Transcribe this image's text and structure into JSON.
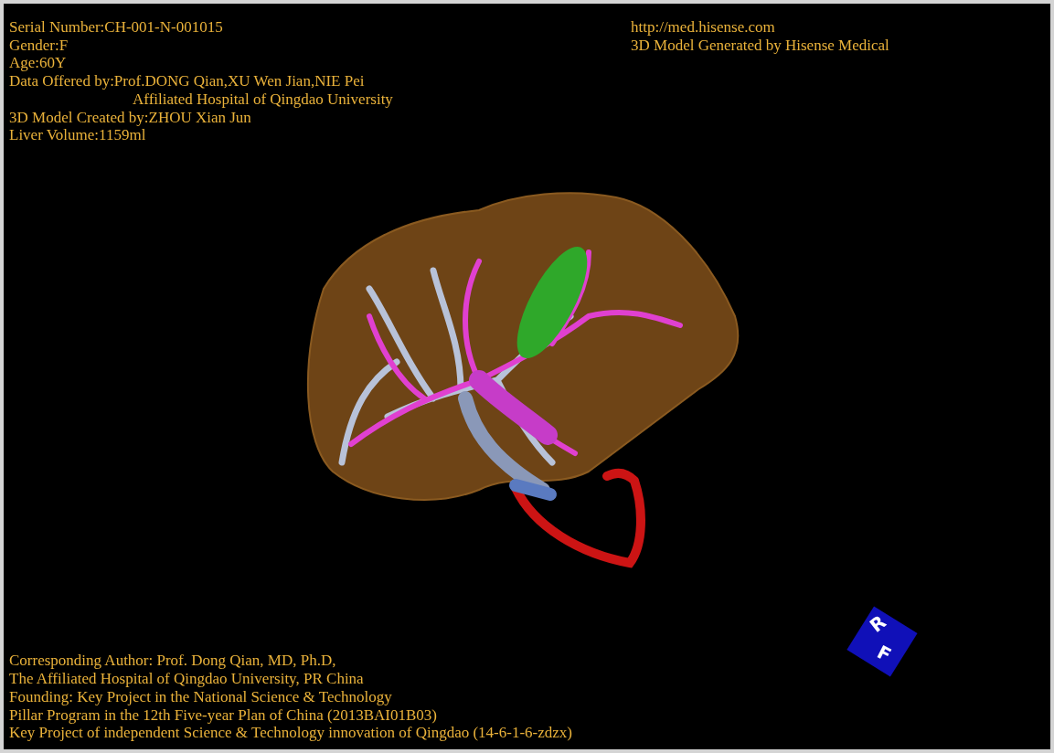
{
  "header_left": [
    {
      "text": "Serial Number:CH-001-N-001015",
      "indented": false
    },
    {
      "text": "Gender:F",
      "indented": false
    },
    {
      "text": "Age:60Y",
      "indented": false
    },
    {
      "text": "Data Offered by:Prof.DONG Qian,XU Wen Jian,NIE Pei",
      "indented": false
    },
    {
      "text": "Affiliated Hospital of Qingdao University",
      "indented": true
    },
    {
      "text": "3D Model Created by:ZHOU Xian Jun",
      "indented": false
    },
    {
      "text": "Liver Volume:1159ml",
      "indented": false
    }
  ],
  "header_right": [
    "http://med.hisense.com",
    "3D Model Generated by Hisense Medical"
  ],
  "footer": [
    "Corresponding Author: Prof. Dong Qian, MD, Ph.D,",
    "The Affiliated Hospital of Qingdao University, PR China",
    "Founding: Key Project in the National Science & Technology",
    "Pillar Program in the 12th Five-year Plan of China (2013BAI01B03)",
    "Key Project of independent Science & Technology innovation of Qingdao (14-6-1-6-zdzx)"
  ],
  "orientation_cube": {
    "faces": [
      "R",
      "F"
    ]
  }
}
